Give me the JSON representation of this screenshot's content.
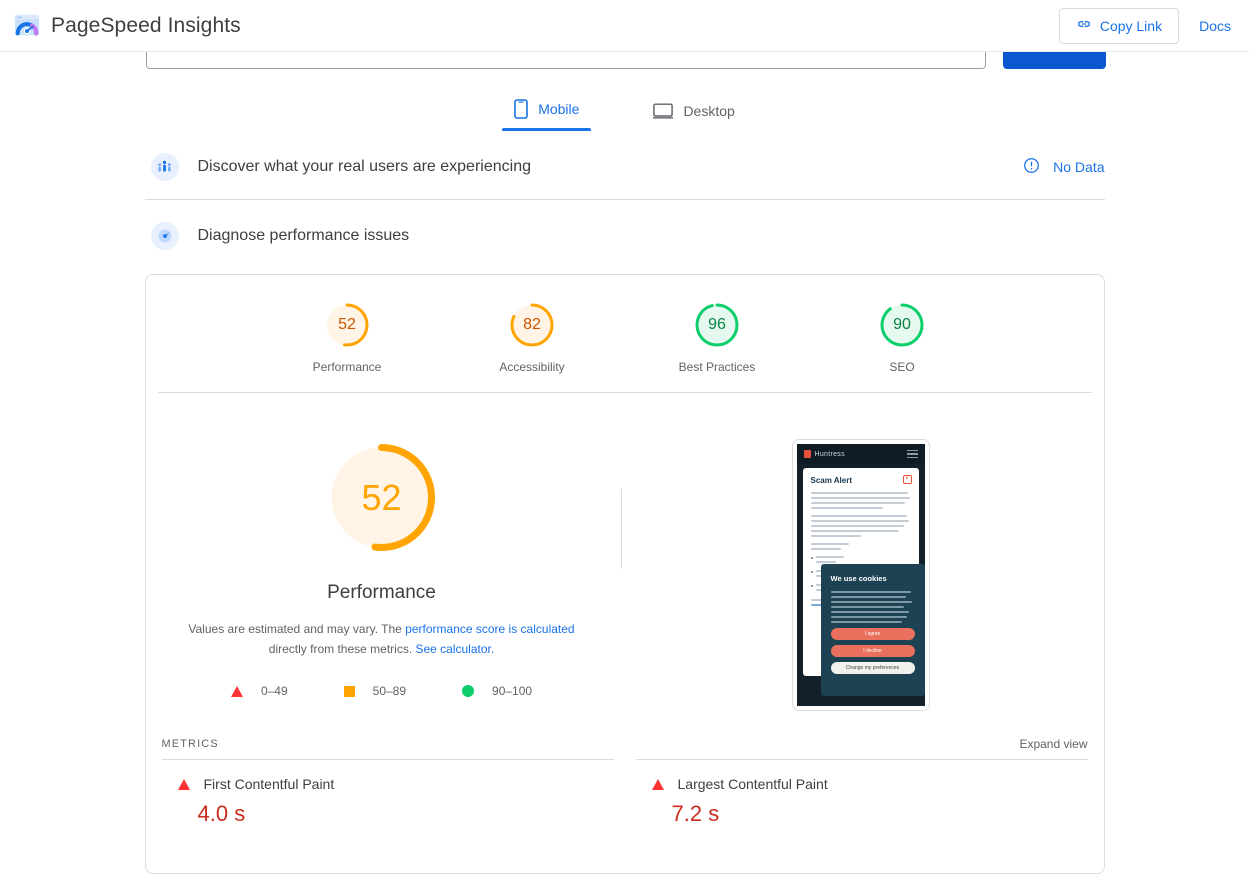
{
  "header": {
    "app_title": "PageSpeed Insights",
    "logo_icon": "pagespeed-gauge-logo",
    "copy_link_label": "Copy Link",
    "copy_link_icon": "link-icon",
    "docs_label": "Docs"
  },
  "search": {
    "value": "",
    "placeholder": "",
    "analyze_label": ""
  },
  "tabs": [
    {
      "label": "Mobile",
      "icon": "phone-icon",
      "active": true
    },
    {
      "label": "Desktop",
      "icon": "monitor-icon",
      "active": false
    }
  ],
  "field_data_section": {
    "icon": "real-users-icon",
    "title": "Discover what your real users are experiencing",
    "status_icon": "info-circle-icon",
    "status_label": "No Data"
  },
  "lab_data_section": {
    "icon": "diagnose-gauge-icon",
    "title": "Diagnose performance issues"
  },
  "category_scores": [
    {
      "label": "Performance",
      "value": 52,
      "color": "#ffa400",
      "text_color": "#cc5500",
      "bg": "#fff4e5"
    },
    {
      "label": "Accessibility",
      "value": 82,
      "color": "#ffa400",
      "text_color": "#cc5500",
      "bg": "#fff4e5"
    },
    {
      "label": "Best Practices",
      "value": 96,
      "color": "#0cce6b",
      "text_color": "#0a8043",
      "bg": "#e6f9ef"
    },
    {
      "label": "SEO",
      "value": 90,
      "color": "#0cce6b",
      "text_color": "#0a8043",
      "bg": "#e6f9ef"
    }
  ],
  "main_score": {
    "value": 52,
    "label": "Performance",
    "color": "#ffa400",
    "bg": "#fff4e5",
    "description_part1": "Values are estimated and may vary. The ",
    "link1": "performance score is calculated",
    "description_part2": " directly from these metrics. ",
    "link2": "See calculator."
  },
  "legend": [
    {
      "shape": "triangle",
      "label": "0–49",
      "color": "#ff3333"
    },
    {
      "shape": "square",
      "label": "50–89",
      "color": "#ffa400"
    },
    {
      "shape": "circle",
      "label": "90–100",
      "color": "#0cce6b"
    }
  ],
  "screenshot_thumbnail": {
    "brand": "Huntress",
    "logo_icon": "huntress-logo-icon",
    "menu_icon": "hamburger-menu-icon",
    "dialog_title": "Scam Alert",
    "close_icon": "close-x-icon",
    "cookie_title": "We use cookies",
    "cookie_buttons": [
      "I agree",
      "I decline",
      "Change my preferences"
    ]
  },
  "metrics": {
    "heading": "METRICS",
    "expand_label": "Expand view",
    "items": [
      {
        "name": "First Contentful Paint",
        "value": "4.0 s",
        "rating": "poor",
        "icon": "red-triangle-icon"
      },
      {
        "name": "Largest Contentful Paint",
        "value": "7.2 s",
        "rating": "poor",
        "icon": "red-triangle-icon"
      }
    ]
  }
}
